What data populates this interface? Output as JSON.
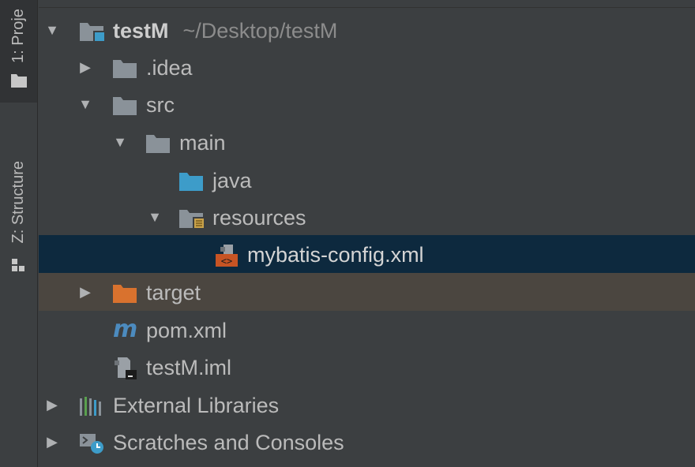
{
  "stripe": {
    "project_tab": "1: Proje",
    "structure_tab": "Z: Structure"
  },
  "tree": {
    "root": {
      "name": "testM",
      "path": "~/Desktop/testM"
    },
    "idea": "idea-folder",
    "nodes": {
      "idea": ".idea",
      "src": "src",
      "main": "main",
      "java": "java",
      "resources": "resources",
      "config": "mybatis-config.xml",
      "target": "target",
      "pom": "pom.xml",
      "iml": "testM.iml",
      "libs": "External Libraries",
      "scratches": "Scratches and Consoles"
    }
  },
  "colors": {
    "background": "#3c3f41",
    "selection": "#0d293e",
    "excluded": "#4b4640",
    "folder": "#8a9299",
    "source_folder": "#3d9cc9",
    "excluded_folder": "#d9722e",
    "text": "#bbbbbb"
  }
}
